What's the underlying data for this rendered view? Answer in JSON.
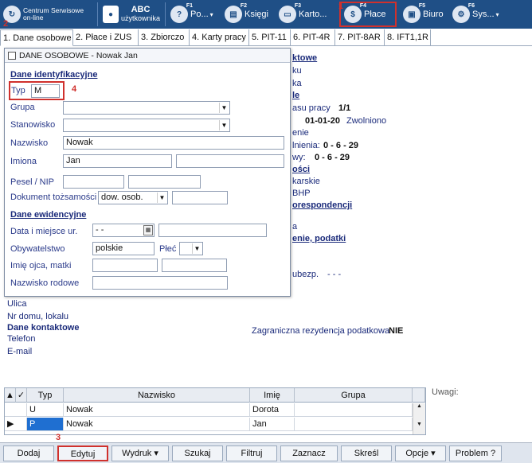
{
  "toolbar": {
    "brand": "Centrum Serwisowe on-line",
    "user_top": "ABC",
    "user_bottom": "użytkownika",
    "items": [
      {
        "key": "F1",
        "label": "Po..."
      },
      {
        "key": "F2",
        "label": "Księgi"
      },
      {
        "key": "F3",
        "label": "Karto..."
      },
      {
        "key": "F4",
        "label": "Płace"
      },
      {
        "key": "F5",
        "label": "Biuro"
      },
      {
        "key": "F6",
        "label": "Sys..."
      }
    ]
  },
  "tabs": [
    "1. Dane osobowe",
    "2. Płace i ZUS",
    "3. Zbiorczo",
    "4. Karty pracy",
    "5. PIT-11",
    "6. PIT-4R",
    "7. PIT-8AR",
    "8. IFT1,1R"
  ],
  "background": {
    "right_col": [
      "ktowe",
      "ku",
      "ka",
      "le",
      "asu pracy",
      "1/1",
      "01-01-20",
      "Zwolniono",
      "enie",
      "lnienia:",
      "0 - 6 - 29",
      "wy:",
      "0 - 6 - 29",
      "ości",
      "karskie",
      "BHP",
      "orespondencji",
      "a",
      "enie, podatki",
      "ubezp.",
      "- - -"
    ],
    "left": [
      "Ulica",
      "Nr domu, lokalu",
      "Dane kontaktowe",
      "Telefon",
      "E-mail"
    ],
    "tax_label": "Zagraniczna rezydencja podatkowa",
    "tax_value": "NIE",
    "uwagi": "Uwagi:"
  },
  "dialog": {
    "title": "DANE OSOBOWE - Nowak Jan",
    "section_id": "Dane identyfikacyjne",
    "typ_label": "Typ",
    "typ_value": "M",
    "grupa_label": "Grupa",
    "stanowisko_label": "Stanowisko",
    "nazwisko_label": "Nazwisko",
    "nazwisko_value": "Nowak",
    "imiona_label": "Imiona",
    "imiona_value": "Jan",
    "pesel_label": "Pesel / NIP",
    "dokument_label": "Dokument tożsamości",
    "dokument_value": "dow. osob.",
    "section_ew": "Dane ewidencyjne",
    "data_label": "Data i miejsce ur.",
    "data_value": "- -",
    "obyw_label": "Obywatelstwo",
    "obyw_value": "polskie",
    "plec_label": "Płeć",
    "imie_ojca_label": "Imię ojca, matki",
    "nazwisko_rod_label": "Nazwisko rodowe"
  },
  "grid": {
    "headers": [
      "Typ",
      "Nazwisko",
      "Imię",
      "Grupa"
    ],
    "rows": [
      [
        "U",
        "Nowak",
        "Dorota",
        ""
      ],
      [
        "P",
        "Nowak",
        "Jan",
        ""
      ]
    ]
  },
  "bottom": [
    "Dodaj",
    "Edytuj",
    "Wydruk",
    "Szukaj",
    "Filtruj",
    "Zaznacz",
    "Skreśl",
    "Opcje",
    "Problem ?"
  ],
  "markers": [
    "1",
    "2",
    "3",
    "4"
  ]
}
